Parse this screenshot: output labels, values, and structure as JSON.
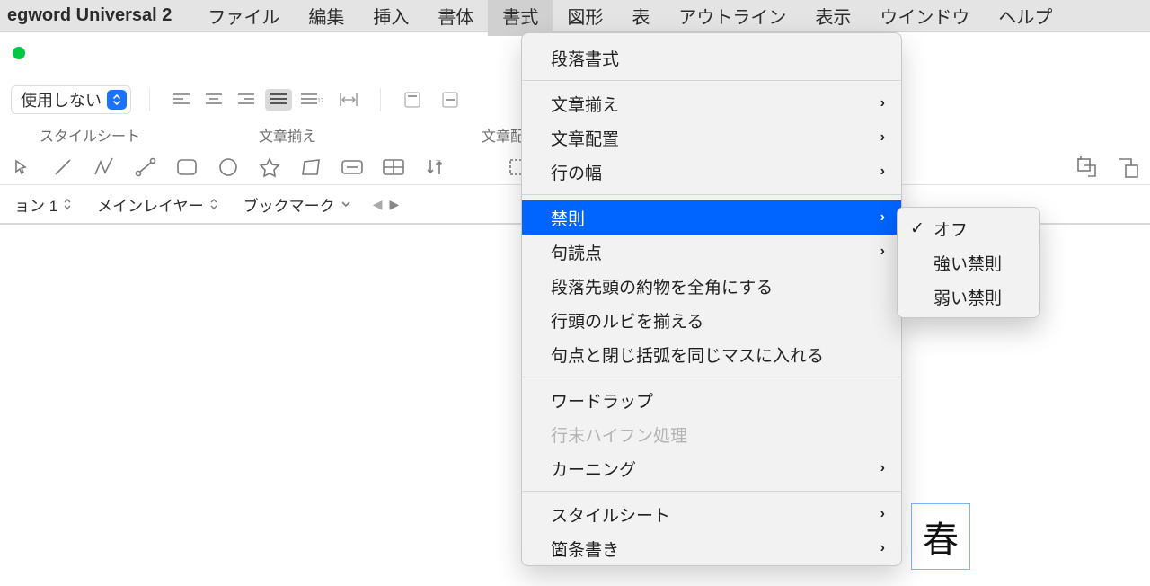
{
  "app_name": "egword Universal 2",
  "menubar": [
    "ファイル",
    "編集",
    "挿入",
    "書体",
    "書式",
    "図形",
    "表",
    "アウトライン",
    "表示",
    "ウインドウ",
    "ヘルプ"
  ],
  "menubar_open_index": 4,
  "toolbar": {
    "style_select": "使用しない",
    "labels": [
      "スタイルシート",
      "文章揃え",
      "文章配"
    ]
  },
  "subbar": {
    "section": "ョン 1",
    "layer": "メインレイヤー",
    "bookmark": "ブックマーク"
  },
  "menu": {
    "items": [
      {
        "label": "段落書式",
        "arrow": false
      },
      {
        "sep": true
      },
      {
        "label": "文章揃え",
        "arrow": true
      },
      {
        "label": "文章配置",
        "arrow": true
      },
      {
        "label": "行の幅",
        "arrow": true
      },
      {
        "sep": true
      },
      {
        "label": "禁則",
        "arrow": true,
        "highlight": true
      },
      {
        "label": "句読点",
        "arrow": true
      },
      {
        "label": "段落先頭の約物を全角にする",
        "arrow": false
      },
      {
        "label": "行頭のルビを揃える",
        "arrow": false
      },
      {
        "label": "句点と閉じ括弧を同じマスに入れる",
        "arrow": false
      },
      {
        "sep": true
      },
      {
        "label": "ワードラップ",
        "arrow": false
      },
      {
        "label": "行末ハイフン処理",
        "arrow": false,
        "disabled": true
      },
      {
        "label": "カーニング",
        "arrow": true
      },
      {
        "sep": true
      },
      {
        "label": "スタイルシート",
        "arrow": true
      },
      {
        "label": "箇条書き",
        "arrow": true
      }
    ]
  },
  "submenu": {
    "items": [
      {
        "label": "オフ",
        "checked": true
      },
      {
        "label": "強い禁則",
        "checked": false
      },
      {
        "label": "弱い禁則",
        "checked": false
      }
    ]
  },
  "canvas": {
    "float_char": "春"
  }
}
